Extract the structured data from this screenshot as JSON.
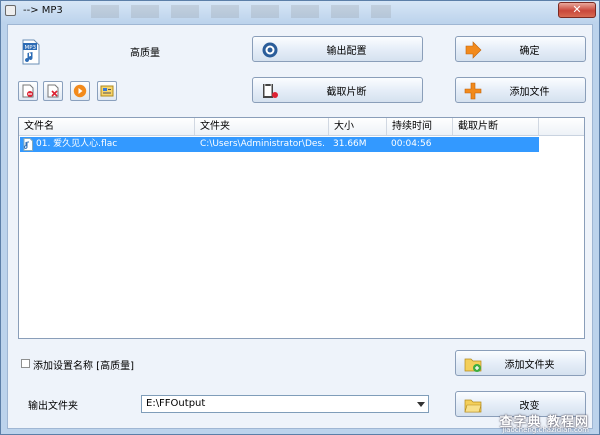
{
  "window": {
    "title": "--> MP3",
    "close": "✕"
  },
  "format_label": "高质量",
  "buttons": {
    "output_config": "输出配置",
    "ok": "确定",
    "clip": "截取片断",
    "add_file": "添加文件",
    "add_folder": "添加文件夹",
    "change": "改变"
  },
  "list": {
    "columns": [
      "文件名",
      "文件夹",
      "大小",
      "持续时间",
      "截取片断"
    ],
    "rows": [
      {
        "name": "01. 爱久见人心.flac",
        "folder": "C:\\Users\\Administrator\\Des...",
        "size": "31.66M",
        "duration": "00:04:56",
        "clip": ""
      }
    ]
  },
  "add_setting_name": "添加设置名称 [高质量]",
  "output_folder_label": "输出文件夹",
  "output_folder_value": "E:\\FFOutput",
  "watermark": {
    "main": "查字典 教程网",
    "sub": "jiaocheng.chazidian.com"
  },
  "colors": {
    "selection": "#3399ff",
    "accent_orange": "#f28a1c"
  }
}
